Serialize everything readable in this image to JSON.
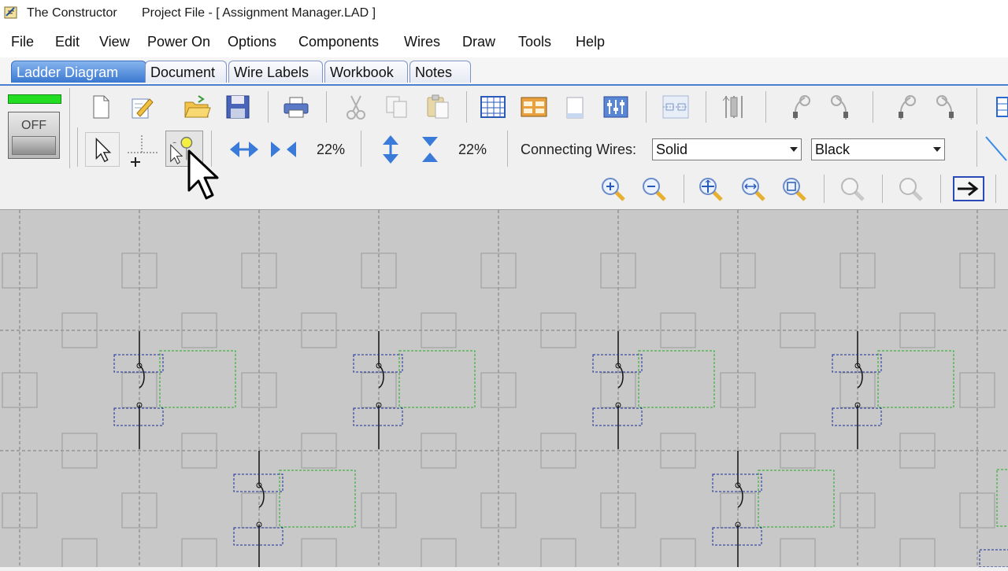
{
  "window": {
    "app_name": "The Constructor",
    "project_title": "Project File - [ Assignment Manager.LAD ]"
  },
  "menu": {
    "items": [
      "File",
      "Edit",
      "View",
      "Power On",
      "Options",
      "Components",
      "Wires",
      "Draw",
      "Tools",
      "Help"
    ]
  },
  "tabs": {
    "items": [
      "Ladder Diagram",
      "Document",
      "Wire Labels",
      "Workbook",
      "Notes"
    ],
    "active": "Ladder Diagram"
  },
  "power_switch": {
    "label": "OFF"
  },
  "zoom": {
    "horizontal_percent": "22%",
    "vertical_percent": "22%"
  },
  "wire_settings": {
    "connecting_label": "Connecting Wires:",
    "style_value": "Solid",
    "color_value": "Black"
  },
  "icons": {
    "standard": [
      "new-file-icon",
      "edit-pencil-icon",
      "open-folder-icon",
      "save-disk-icon",
      "print-icon",
      "cut-icon",
      "copy-icon",
      "paste-icon",
      "grid-view-icon",
      "table-view-icon",
      "page-icon",
      "component-view-icon",
      "align-icon",
      "slider-icon",
      "wire-left-icon",
      "wire-right-icon",
      "wire-left-2-icon",
      "wire-right-2-icon"
    ],
    "tools": [
      "select-arrow-icon",
      "crosshair-grid-icon",
      "add-component-icon",
      "compress-horizontal-icon",
      "expand-horizontal-icon",
      "expand-vertical-icon",
      "compress-vertical-icon"
    ],
    "zoom": [
      "zoom-in-icon",
      "zoom-out-icon",
      "zoom-fit-icon",
      "zoom-width-icon",
      "zoom-page-icon",
      "zoom-disabled-1-icon",
      "zoom-disabled-2-icon",
      "next-arrow-icon"
    ]
  },
  "colors": {
    "active_tab": "#3a78d0",
    "canvas_bg": "#c8c8c8",
    "contact_box": "#1a2a9a",
    "label_box": "#22aa22",
    "power_led": "#22dd22"
  }
}
